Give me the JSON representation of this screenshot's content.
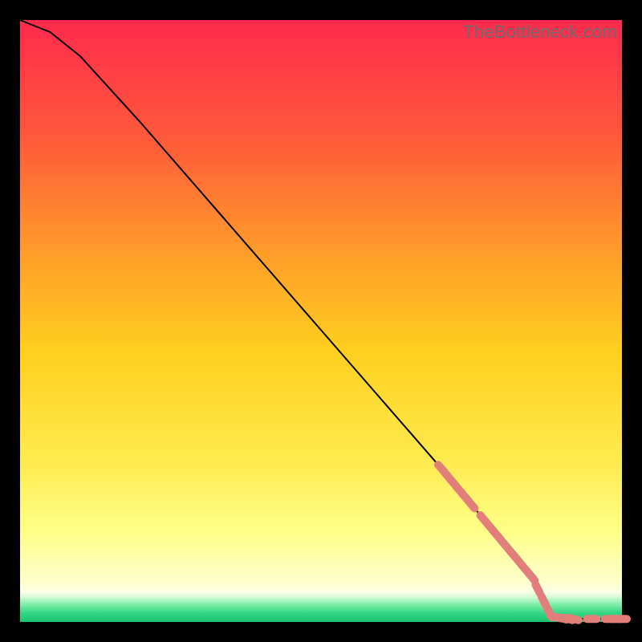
{
  "watermark": "TheBottleneck.com",
  "chart_data": {
    "type": "line",
    "title": "",
    "xlabel": "",
    "ylabel": "",
    "xlim": [
      0,
      100
    ],
    "ylim": [
      0,
      100
    ],
    "grid": false,
    "gradient_colors": {
      "top": "#ff2a4d",
      "mid_upper": "#ff8a2a",
      "mid": "#ffd21f",
      "mid_lower": "#ffff6a",
      "near_bottom": "#ffffdd",
      "green_band_top": "#8cf2a0",
      "green_band_bottom": "#27d47a"
    },
    "curve": {
      "description": "Monotone decreasing curve from top-left to bottom-right; slight convex shoulder near start, near-linear middle, flat at y≈0 after x≈88.",
      "x": [
        0,
        5,
        10,
        20,
        30,
        40,
        50,
        60,
        70,
        75,
        80,
        85,
        88,
        92,
        96,
        100
      ],
      "y": [
        100,
        98,
        94,
        83,
        71.5,
        60,
        48.5,
        37,
        25.5,
        19.5,
        13.5,
        7.5,
        1.5,
        0.5,
        0.5,
        0.5
      ]
    },
    "markers": {
      "description": "Salmon rounded-capsule markers placed along the curve; dense cluster on diagonal segment ~x=70–88, then sparse along y≈0 tail.",
      "color": "#e37f7b",
      "points": [
        {
          "x": 70.0,
          "y": 25.5
        },
        {
          "x": 71.0,
          "y": 24.3
        },
        {
          "x": 72.0,
          "y": 23.1
        },
        {
          "x": 73.0,
          "y": 21.9
        },
        {
          "x": 74.0,
          "y": 20.7
        },
        {
          "x": 75.0,
          "y": 19.5
        },
        {
          "x": 77.0,
          "y": 17.1
        },
        {
          "x": 78.0,
          "y": 15.9
        },
        {
          "x": 79.0,
          "y": 14.7
        },
        {
          "x": 80.0,
          "y": 13.5
        },
        {
          "x": 81.0,
          "y": 12.3
        },
        {
          "x": 82.0,
          "y": 11.1
        },
        {
          "x": 83.0,
          "y": 9.9
        },
        {
          "x": 84.0,
          "y": 8.7
        },
        {
          "x": 85.0,
          "y": 7.5
        },
        {
          "x": 86.0,
          "y": 5.5
        },
        {
          "x": 87.0,
          "y": 3.5
        },
        {
          "x": 88.0,
          "y": 1.5
        },
        {
          "x": 89.0,
          "y": 0.8
        },
        {
          "x": 90.0,
          "y": 0.6
        },
        {
          "x": 91.0,
          "y": 0.5
        },
        {
          "x": 92.0,
          "y": 0.5
        },
        {
          "x": 95.0,
          "y": 0.5
        },
        {
          "x": 98.0,
          "y": 0.5
        },
        {
          "x": 99.0,
          "y": 0.5
        },
        {
          "x": 100.0,
          "y": 0.5
        }
      ]
    }
  }
}
